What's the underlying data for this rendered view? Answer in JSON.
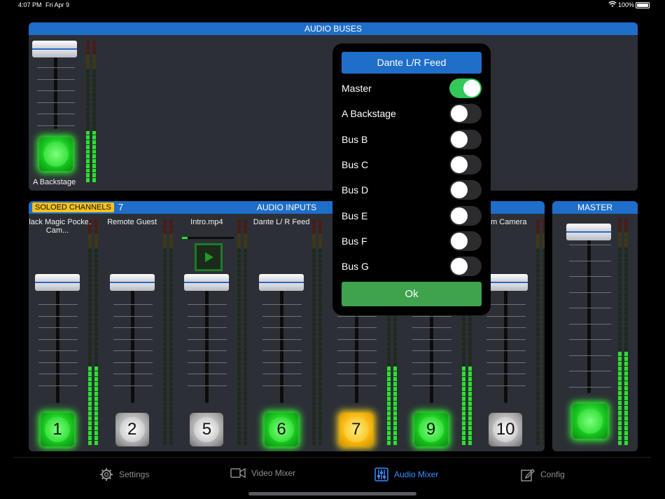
{
  "status_bar": {
    "time": "4:07 PM",
    "date": "Fri Apr 9",
    "battery": "100%",
    "icons": [
      "wifi-icon",
      "battery-icon"
    ]
  },
  "audio_buses": {
    "header": "AUDIO BUSES",
    "bus": {
      "label": "A Backstage",
      "fader_level": 0.95,
      "meter_level": 0.35
    }
  },
  "audio_inputs": {
    "header": "AUDIO INPUTS",
    "soloed_label": "SOLOED CHANNELS",
    "soloed_count": "7",
    "channels": [
      {
        "name": "Black Magic Pocket Cam...",
        "number": "1",
        "state": "green",
        "meter_level": 0.35
      },
      {
        "name": "Remote Guest",
        "number": "2",
        "state": "gray",
        "meter_level": 0.0
      },
      {
        "name": "Intro.mp4",
        "number": "5",
        "state": "gray",
        "meter_level": 0.0,
        "has_play": true,
        "progress": 0.1
      },
      {
        "name": "Dante L/ R Feed",
        "number": "6",
        "state": "green",
        "meter_level": 0.0
      },
      {
        "name": "",
        "number": "7",
        "state": "yellow",
        "meter_level": 0.35
      },
      {
        "name": "",
        "number": "9",
        "state": "green",
        "meter_level": 0.35
      },
      {
        "name": "...m Camera",
        "number": "10",
        "state": "gray",
        "meter_level": 0.0
      }
    ]
  },
  "master": {
    "header": "MASTER",
    "fader_level": 0.98,
    "meter_level": 0.42
  },
  "popup": {
    "title": "Dante L/R Feed",
    "rows": [
      {
        "label": "Master",
        "on": true
      },
      {
        "label": "A Backstage",
        "on": false
      },
      {
        "label": "Bus B",
        "on": false
      },
      {
        "label": "Bus C",
        "on": false
      },
      {
        "label": "Bus D",
        "on": false
      },
      {
        "label": "Bus E",
        "on": false
      },
      {
        "label": "Bus F",
        "on": false
      },
      {
        "label": "Bus G",
        "on": false
      }
    ],
    "ok_label": "Ok"
  },
  "tabs": [
    {
      "label": "Settings",
      "icon": "gear-icon",
      "active": false
    },
    {
      "label": "Video Mixer",
      "icon": "video-camera-icon",
      "active": false
    },
    {
      "label": "Audio Mixer",
      "icon": "sliders-icon",
      "active": true
    },
    {
      "label": "Config",
      "icon": "edit-icon",
      "active": false
    }
  ],
  "colors": {
    "accent_blue": "#1f6ec9",
    "tab_active": "#3a8dff",
    "ok_green": "#3fa34d",
    "toggle_on": "#34c759",
    "solo_yellow": "#f6c21c"
  }
}
